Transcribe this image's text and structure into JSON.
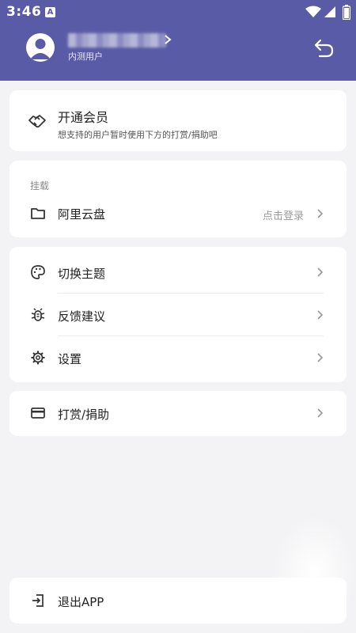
{
  "status_bar": {
    "time": "3:46",
    "notification_letter": "A"
  },
  "header": {
    "account_type": "内测用户"
  },
  "vip_card": {
    "title": "开通会员",
    "description": "想支持的用户暂时使用下方的打赏/捐助吧"
  },
  "mount_card": {
    "section_title": "挂载",
    "item_label": "阿里云盘",
    "item_action": "点击登录"
  },
  "settings_card": {
    "theme_label": "切换主题",
    "feedback_label": "反馈建议",
    "settings_label": "设置"
  },
  "donate_card": {
    "label": "打赏/捐助"
  },
  "logout_card": {
    "label": "退出APP"
  },
  "colors": {
    "header": "#5a5ba6",
    "background": "#f3f3f5",
    "card": "#ffffff"
  }
}
